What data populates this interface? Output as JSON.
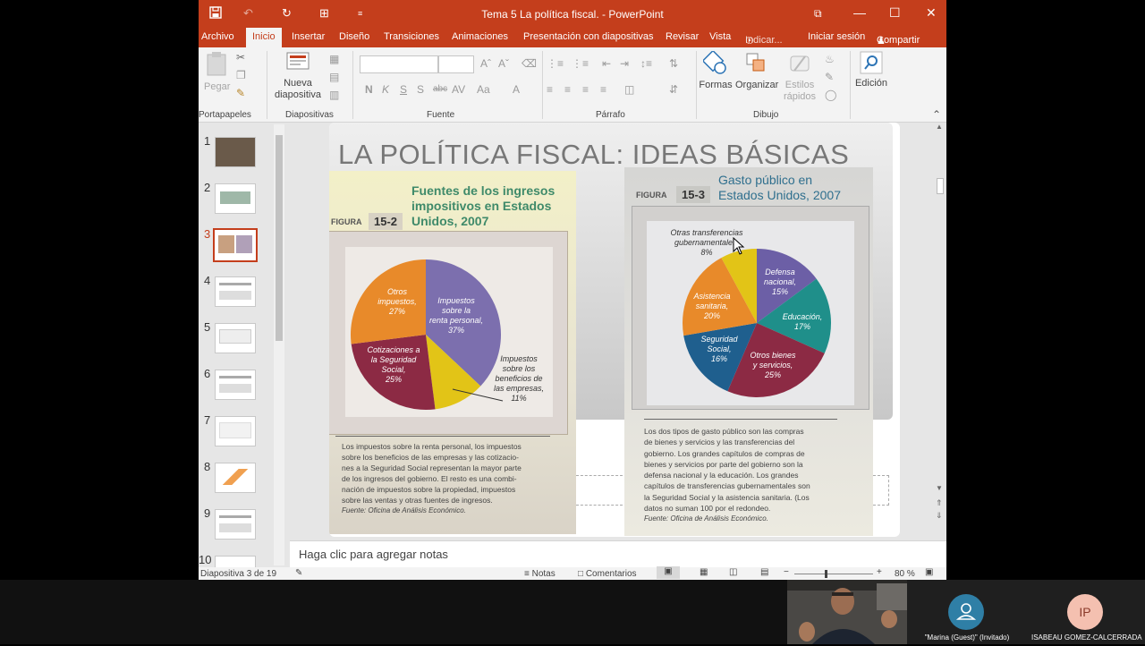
{
  "window": {
    "title": "Tema 5 La política fiscal.  -  PowerPoint",
    "minimize": "—",
    "maximize": "☐",
    "close": "✕",
    "restore": "⧉"
  },
  "quick_access": {
    "save": "💾",
    "undo": "↶",
    "redo": "↻",
    "present": "⊞",
    "customize": "≡"
  },
  "tabs": [
    "Archivo",
    "Inicio",
    "Insertar",
    "Diseño",
    "Transiciones",
    "Animaciones",
    "Presentación con diapositivas",
    "Revisar",
    "Vista"
  ],
  "tell_me": "Indicar...",
  "sign_in": "Iniciar sesión",
  "share": "Compartir",
  "ribbon": {
    "paste": "Pegar",
    "new_slide_1": "Nueva",
    "new_slide_2": "diapositiva",
    "groups": {
      "clipboard": "Portapapeles",
      "slides": "Diapositivas",
      "font": "Fuente",
      "paragraph": "Párrafo",
      "drawing": "Dibujo"
    },
    "font_buttons": [
      "N",
      "K",
      "S",
      "S",
      "abc",
      "AV",
      "Aa",
      "A"
    ],
    "shapes": "Formas",
    "arrange": "Organizar",
    "quick_styles_1": "Estilos",
    "quick_styles_2": "rápidos",
    "editing": "Edición"
  },
  "thumbnails": [
    "1",
    "2",
    "3",
    "4",
    "5",
    "6",
    "7",
    "8",
    "9",
    "10"
  ],
  "slide": {
    "title": "LA POLÍTICA FISCAL: IDEAS BÁSICAS",
    "fig_left": {
      "label": "FIGURA",
      "number": "15-2",
      "title_1": "Fuentes de los ingresos",
      "title_2": "impositivos en Estados",
      "title_3": "Unidos, 2007",
      "caption": [
        "Los impuestos sobre la renta personal, los impuestos",
        "sobre los beneficios de las empresas y las cotizacio-",
        "nes a la Seguridad Social representan la mayor parte",
        "de los ingresos del gobierno. El resto es una combi-",
        "nación de impuestos sobre la propiedad, impuestos",
        "sobre las ventas y otras fuentes de ingresos."
      ],
      "source": "Fuente: Oficina de Análisis Económico."
    },
    "fig_right": {
      "label": "FIGURA",
      "number": "15-3",
      "title_1": "Gasto público en",
      "title_2": "Estados Unidos, 2007",
      "caption": [
        "Los dos tipos de gasto público son las compras",
        "de bienes y servicios y las transferencias del",
        "gobierno. Los grandes capítulos de compras de",
        "bienes y servicios por parte del gobierno son la",
        "defensa nacional y la educación. Los grandes",
        "capítulos de transferencias gubernamentales son",
        "la Seguridad Social y la asistencia sanitaria. (Los",
        "datos no suman 100 por el redondeo."
      ],
      "source": "Fuente: Oficina de Análisis Económico."
    }
  },
  "chart_data": [
    {
      "type": "pie",
      "title": "Fuentes de los ingresos impositivos en Estados Unidos, 2007",
      "series": [
        {
          "name": "Impuestos sobre la renta personal",
          "line1": "Impuestos",
          "line2": "sobre la",
          "line3": "renta personal,",
          "pct": "37%",
          "value": 37,
          "color": "#7c6fae"
        },
        {
          "name": "Impuestos sobre los beneficios de las empresas",
          "line1": "Impuestos",
          "line2": "sobre los",
          "line3": "beneficios de",
          "line4": "las empresas,",
          "pct": "11%",
          "value": 11,
          "color": "#e2c417"
        },
        {
          "name": "Cotizaciones a la Seguridad Social",
          "line1": "Cotizaciones a",
          "line2": "la Seguridad",
          "line3": "Social,",
          "pct": "25%",
          "value": 25,
          "color": "#8c2a44"
        },
        {
          "name": "Otros impuestos",
          "line1": "Otros",
          "line2": "impuestos,",
          "pct": "27%",
          "value": 27,
          "color": "#e88a2a"
        }
      ]
    },
    {
      "type": "pie",
      "title": "Gasto público en Estados Unidos, 2007",
      "series": [
        {
          "name": "Defensa nacional",
          "line1": "Defensa",
          "line2": "nacional,",
          "pct": "15%",
          "value": 15,
          "color": "#6c5fa6"
        },
        {
          "name": "Educación",
          "line1": "Educación,",
          "pct": "17%",
          "value": 17,
          "color": "#1f8f8a"
        },
        {
          "name": "Otros bienes y servicios",
          "line1": "Otros bienes",
          "line2": "y servicios,",
          "pct": "25%",
          "value": 25,
          "color": "#8c2a44"
        },
        {
          "name": "Seguridad Social",
          "line1": "Seguridad",
          "line2": "Social,",
          "pct": "16%",
          "value": 16,
          "color": "#1f5f8e"
        },
        {
          "name": "Asistencia sanitaria",
          "line1": "Asistencia",
          "line2": "sanitaria,",
          "pct": "20%",
          "value": 20,
          "color": "#e88a2a"
        },
        {
          "name": "Otras transferencias gubernamentales",
          "line1": "Otras transferencias",
          "line2": "gubernamentales,",
          "pct": "8%",
          "value": 8,
          "color": "#e2c417"
        }
      ]
    }
  ],
  "notes_placeholder": "Haga clic para agregar notas",
  "status": {
    "slide_info": "Diapositiva 3 de 19",
    "notes": "Notas",
    "comments": "Comentarios",
    "zoom": "80 %"
  },
  "participants": [
    {
      "name": "\"Marina (Guest)\" (Invitado)",
      "initials": "",
      "color": "#2f7fa6"
    },
    {
      "name": "ISABEAU GOMEZ-CALCERRADA PE...",
      "initials": "IP",
      "color": "#f4c0b0"
    }
  ]
}
